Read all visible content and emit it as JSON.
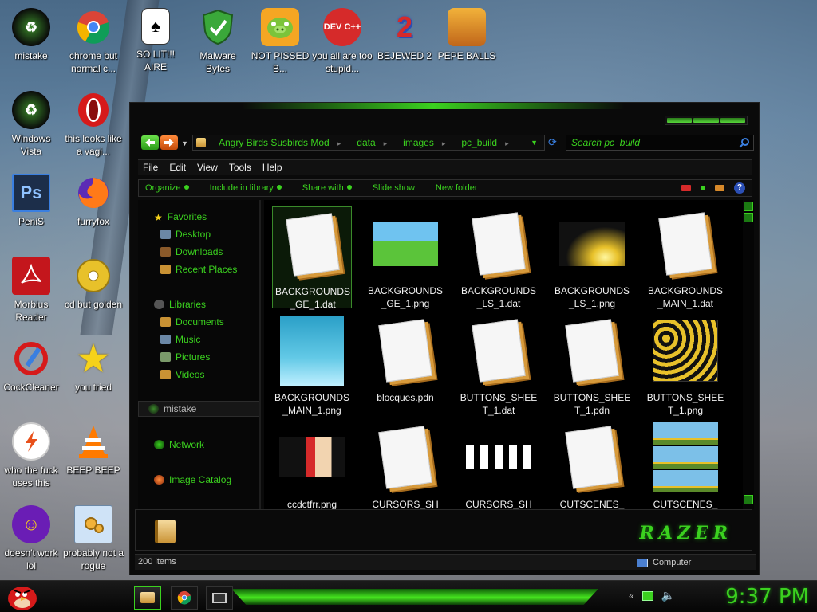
{
  "desktop": {
    "icons": [
      {
        "label": "mistake"
      },
      {
        "label": "chrome but normal c..."
      },
      {
        "label": "SO LIT!!! AIRE"
      },
      {
        "label": "Malware Bytes"
      },
      {
        "label": "NOT PISSED B..."
      },
      {
        "label": "you all are too stupid..."
      },
      {
        "label": "BEJEWED 2"
      },
      {
        "label": "PEPE BALLS"
      },
      {
        "label": "Windows Vista"
      },
      {
        "label": "this looks like a vagi..."
      },
      {
        "label": "PeniS"
      },
      {
        "label": "furryfox"
      },
      {
        "label": "Morbius Reader"
      },
      {
        "label": "cd but golden"
      },
      {
        "label": "CockCleaner"
      },
      {
        "label": "you tried"
      },
      {
        "label": "who the fuck uses this"
      },
      {
        "label": "BEEP BEEP"
      },
      {
        "label": "doesn't work lol"
      },
      {
        "label": "probably not a rogue"
      }
    ],
    "icon_glyphs": {
      "devcpp": "DEV C++",
      "bejeweled": "2",
      "photoshop": "Ps"
    }
  },
  "explorer": {
    "breadcrumb": [
      "Angry Birds Susbirds Mod",
      "data",
      "images",
      "pc_build"
    ],
    "search_placeholder": "Search pc_build",
    "menu": [
      "File",
      "Edit",
      "View",
      "Tools",
      "Help"
    ],
    "commands": [
      "Organize",
      "Include in library",
      "Share with",
      "Slide show",
      "New folder"
    ],
    "help_glyph": "?",
    "nav": {
      "favorites_label": "Favorites",
      "favorites": [
        "Desktop",
        "Downloads",
        "Recent Places"
      ],
      "libraries_label": "Libraries",
      "libraries": [
        "Documents",
        "Music",
        "Pictures",
        "Videos"
      ],
      "user_label": "mistake",
      "network_label": "Network",
      "image_catalog_label": "Image Catalog"
    },
    "files": [
      {
        "name": "BACKGROUNDS_GE_1.dat",
        "kind": "doc",
        "selected": true
      },
      {
        "name": "BACKGROUNDS_GE_1.png",
        "kind": "grass"
      },
      {
        "name": "BACKGROUNDS_LS_1.dat",
        "kind": "doc"
      },
      {
        "name": "BACKGROUNDS_LS_1.png",
        "kind": "light"
      },
      {
        "name": "BACKGROUNDS_MAIN_1.dat",
        "kind": "doc"
      },
      {
        "name": "BACKGROUNDS_MAIN_1.png",
        "kind": "water"
      },
      {
        "name": "blocques.pdn",
        "kind": "doc"
      },
      {
        "name": "BUTTONS_SHEET_1.dat",
        "kind": "doc"
      },
      {
        "name": "BUTTONS_SHEET_1.pdn",
        "kind": "doc"
      },
      {
        "name": "BUTTONS_SHEET_1.png",
        "kind": "sprites"
      },
      {
        "name": "ccdctfrr.png",
        "kind": "chars"
      },
      {
        "name": "CURSORS_SH",
        "kind": "doc"
      },
      {
        "name": "CURSORS_SH",
        "kind": "hands"
      },
      {
        "name": "CUTSCENES_",
        "kind": "doc"
      },
      {
        "name": "CUTSCENES_",
        "kind": "scenes"
      }
    ],
    "brand": "RAZER",
    "status": {
      "items": "200 items",
      "zone": "Computer"
    }
  },
  "taskbar": {
    "clock": "9:37 PM"
  },
  "colors": {
    "accent_green": "#3bd11f",
    "window_bg": "#0a0a0a"
  }
}
